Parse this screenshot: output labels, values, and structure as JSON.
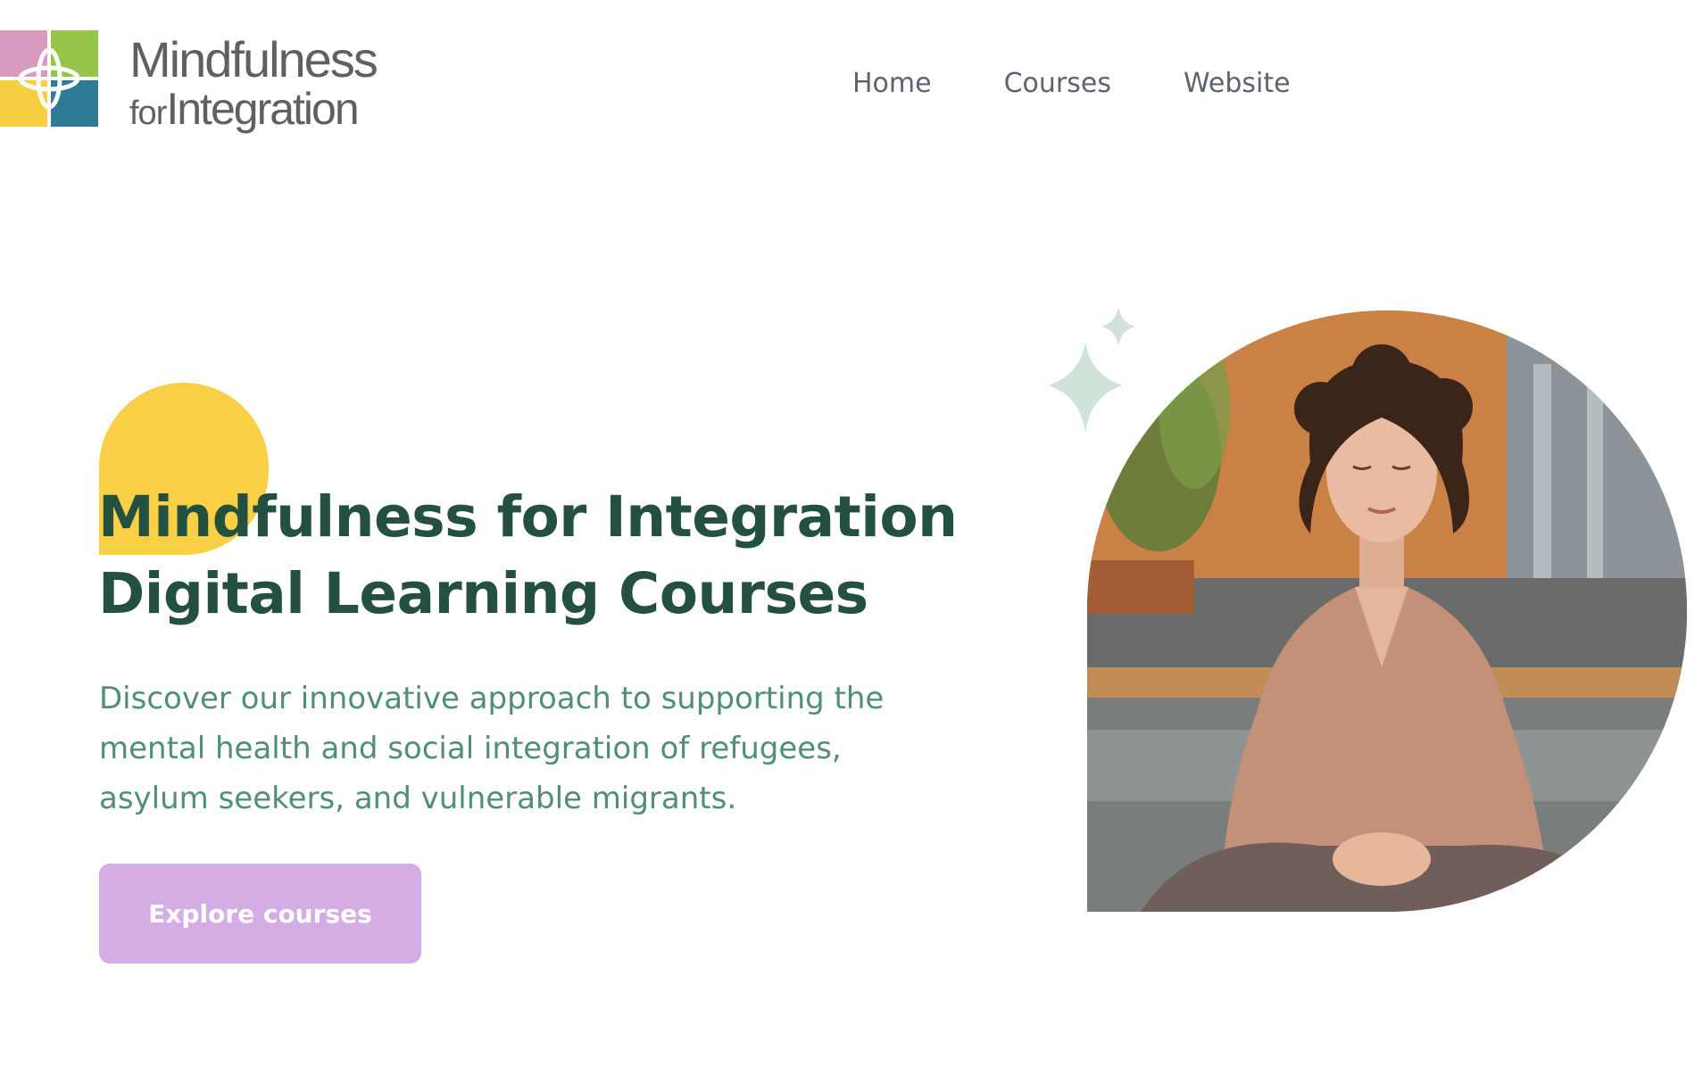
{
  "brand": {
    "name_line1": "Mindfulness",
    "name_line2_prefix": "for",
    "name_line2_main": "Integration",
    "logo_colors": [
      "#d69bbf",
      "#94c44a",
      "#f7cf43",
      "#2e7b96"
    ]
  },
  "nav": {
    "items": [
      {
        "label": "Home"
      },
      {
        "label": "Courses"
      },
      {
        "label": "Website"
      }
    ]
  },
  "hero": {
    "title_line1": "Mindfulness for Integration",
    "title_line2": "Digital Learning Courses",
    "subtitle_line1": "Discover our innovative approach to supporting the",
    "subtitle_line2": "mental health and social integration of refugees,",
    "subtitle_line3": "asylum seekers, and vulnerable migrants.",
    "cta_label": "Explore courses"
  },
  "colors": {
    "title": "#24503f",
    "subtitle": "#4f8f72",
    "accent_sun": "#f8cf45",
    "cta_bg": "#d4ade4",
    "sparkle": "#cfe3d9",
    "nav_text": "#5b6470"
  },
  "icons": {
    "sparkles": "sparkle-icon",
    "logo": "four-petal-logo"
  }
}
